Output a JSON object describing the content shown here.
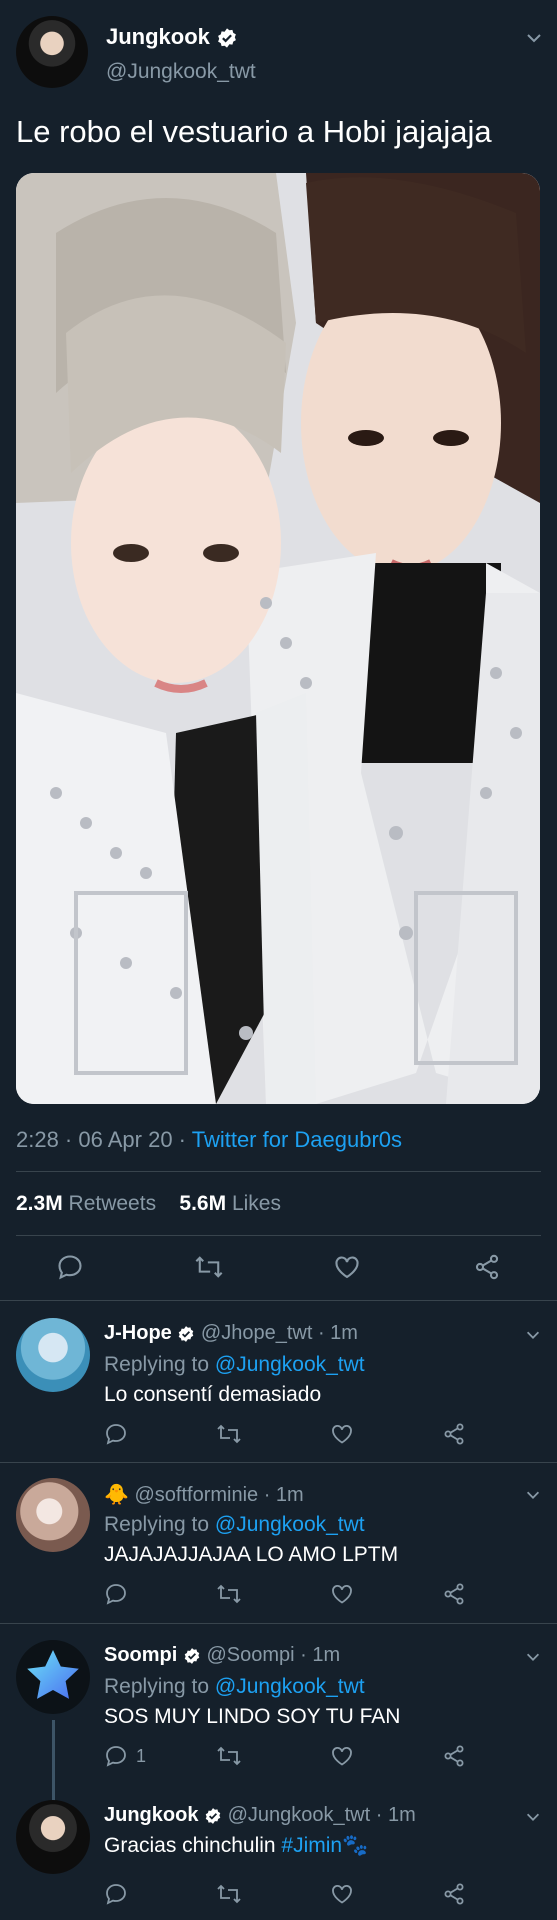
{
  "main_tweet": {
    "author_name": "Jungkook",
    "author_handle": "@Jungkook_twt",
    "text": "Le robo el vestuario a Hobi jajajaja",
    "time": "2:28 · 06 Apr 20 · ",
    "source": "Twitter for Daegubr0s",
    "retweets_count": "2.3M",
    "retweets_label": "Retweets",
    "likes_count": "5.6M",
    "likes_label": "Likes"
  },
  "replies": [
    {
      "name": "J-Hope",
      "verified": true,
      "handle": "@Jhope_twt",
      "time": " · 1m",
      "replying_prefix": "Replying to ",
      "replying_to": "@Jungkook_twt",
      "text": "Lo consentí demasiado",
      "reply_count": ""
    },
    {
      "name": "",
      "emoji": "🐥",
      "handle": "@softforminie",
      "time": " · 1m",
      "replying_prefix": "Replying to ",
      "replying_to": "@Jungkook_twt",
      "text": "JAJAJAJJAJAA LO AMO LPTM",
      "reply_count": ""
    },
    {
      "name": "Soompi",
      "verified": true,
      "handle": "@Soompi",
      "time": " · 1m",
      "replying_prefix": "Replying to ",
      "replying_to": "@Jungkook_twt",
      "text": "SOS MUY LINDO SOY TU FAN",
      "reply_count": "1"
    },
    {
      "name": "Jungkook",
      "verified": true,
      "handle": "@Jungkook_twt",
      "time": " · 1m",
      "text": "Gracias chinchulin ",
      "hashtag": "#Jimin",
      "emoji": "🐾"
    }
  ],
  "colors": {
    "background": "#15202b",
    "accent": "#1da1f2",
    "muted": "#8899a6",
    "divider": "#38444d"
  },
  "icons": [
    "verified-badge-icon",
    "chevron-down-icon",
    "reply-icon",
    "retweet-icon",
    "like-icon",
    "share-icon"
  ]
}
